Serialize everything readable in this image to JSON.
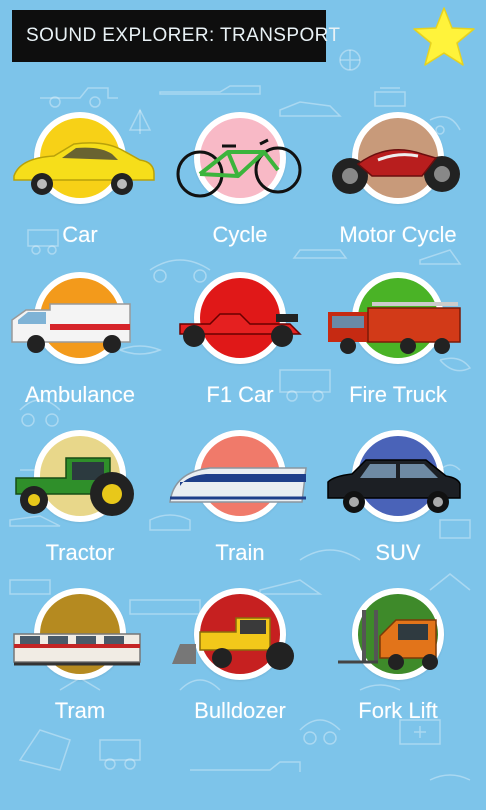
{
  "header": {
    "title": "SOUND EXPLORER: TRANSPORT",
    "favorites_icon": "star-icon"
  },
  "colors": {
    "background": "#7dc4ea",
    "title_bg": "#0e0e0e",
    "title_text": "#e9f2f6",
    "star": "#fff33b",
    "label_text": "#ffffff"
  },
  "vehicles": [
    {
      "label": "Car",
      "icon": "car-icon",
      "disc_color": "#f7d117"
    },
    {
      "label": "Cycle",
      "icon": "bicycle-icon",
      "disc_color": "#f8b9c6"
    },
    {
      "label": "Motor Cycle",
      "icon": "motorcycle-icon",
      "disc_color": "#c89a7a"
    },
    {
      "label": "Ambulance",
      "icon": "ambulance-icon",
      "disc_color": "#f39a1b"
    },
    {
      "label": "F1 Car",
      "icon": "f1-car-icon",
      "disc_color": "#e01818"
    },
    {
      "label": "Fire Truck",
      "icon": "fire-truck-icon",
      "disc_color": "#4ab326"
    },
    {
      "label": "Tractor",
      "icon": "tractor-icon",
      "disc_color": "#e8d78a"
    },
    {
      "label": "Train",
      "icon": "train-icon",
      "disc_color": "#f07a6a"
    },
    {
      "label": "SUV",
      "icon": "suv-icon",
      "disc_color": "#4a63b8"
    },
    {
      "label": "Tram",
      "icon": "tram-icon",
      "disc_color": "#b58a20"
    },
    {
      "label": "Bulldozer",
      "icon": "bulldozer-icon",
      "disc_color": "#c62020"
    },
    {
      "label": "Fork Lift",
      "icon": "forklift-icon",
      "disc_color": "#3e8a2a"
    }
  ]
}
